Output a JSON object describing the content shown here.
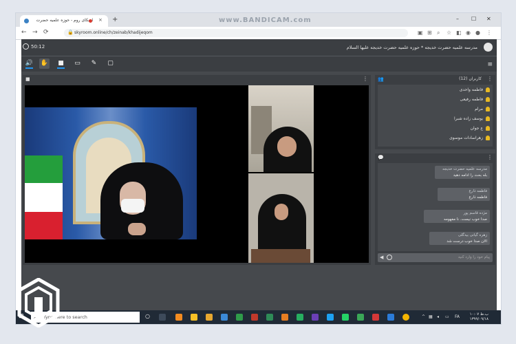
{
  "browser": {
    "tab_title": "اسکای روم - حوزه علمیه حضرت",
    "tab_close": "×",
    "new_tab": "+",
    "recording_watermark": "www.BANDICAM.com",
    "url": "skyroom.online/ch/zeinab/khadijeqom",
    "nav": {
      "back": "←",
      "forward": "→",
      "reload": "⟳"
    },
    "window_controls": {
      "minimize": "–",
      "maximize": "☐",
      "close": "✕"
    }
  },
  "app": {
    "timer": "50:12",
    "room_title": "مدرسه علمیه حضرت خدیجه * حوزه علمیه حضرت خدیجه علیها السلام",
    "tools": [
      {
        "icon": "speaker-icon",
        "glyph": "🔊",
        "selected": false
      },
      {
        "icon": "hand-icon",
        "glyph": "✋",
        "selected": true
      },
      {
        "icon": "camera-icon",
        "glyph": "■",
        "selected": false
      },
      {
        "icon": "screen-icon",
        "glyph": "▭",
        "selected": false
      },
      {
        "icon": "brush-icon",
        "glyph": "✎",
        "selected": false
      },
      {
        "icon": "file-icon",
        "glyph": "▢",
        "selected": false
      }
    ],
    "menu_glyph": "≡"
  },
  "users_panel": {
    "title": "کاربران (12)",
    "users": [
      "فاطمه واحدی",
      "فاطمه رفیعی",
      "مرام",
      "یوسف زاده شبرا",
      "ع جوان",
      "زهراسادات موسوی"
    ]
  },
  "chat_panel": {
    "messages": [
      {
        "name": "مدرسه علمیه حضرت خدیجه",
        "text": "بله بحث را ادامه دهید"
      },
      {
        "name": "فاطمه ذارع",
        "text": "فاطمه ذارع"
      },
      {
        "name": "مژده قاسم پور",
        "text": "صدا خوب نیست. نا مفهومه"
      },
      {
        "name": "زهره گیانی بیدگلی",
        "text": "الان صدا خوب درست شد"
      }
    ],
    "input_placeholder": "پیام خود را وارد کنید"
  },
  "taskbar": {
    "search_placeholder": "Type here to search",
    "time": "۱۰:۰۷ ب.ظ",
    "date": "۱۳۹۹/۰۹/۱۸",
    "lang": "FA"
  },
  "colors": {
    "app_bg": "#46494d",
    "panel_bg": "#3b3e42",
    "accent": "#2196f3",
    "user_icon": "#e8b923",
    "taskbar": "#202a36"
  }
}
